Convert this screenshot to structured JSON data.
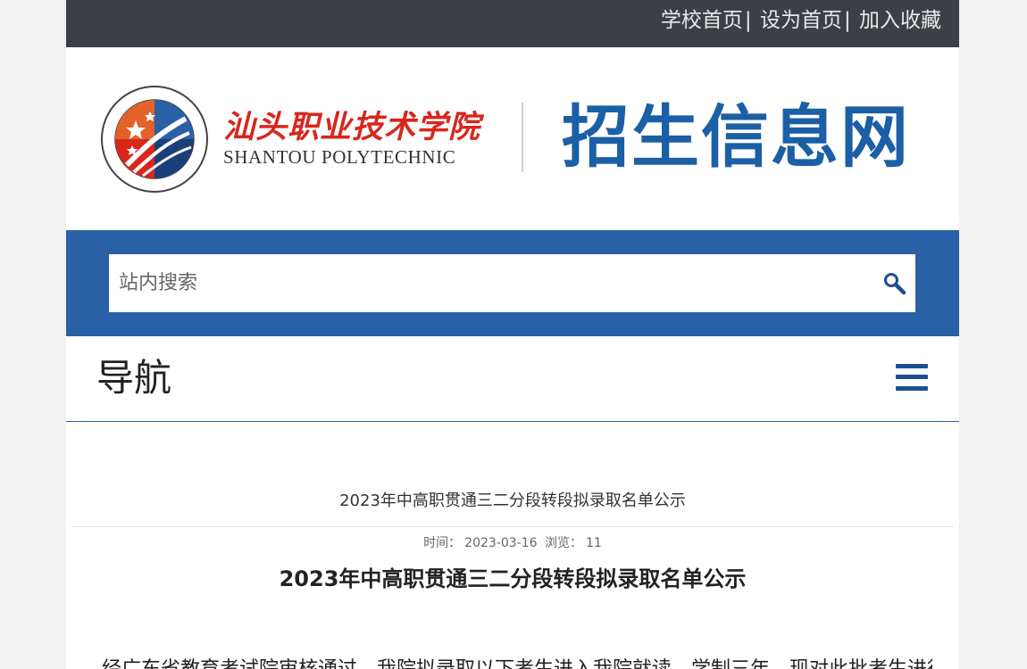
{
  "topbar": {
    "links": [
      "学校首页",
      "设为首页",
      "加入收藏"
    ],
    "separator": "|"
  },
  "header": {
    "school_name_cn": "汕头职业技术学院",
    "school_name_en": "SHANTOU POLYTECHNIC",
    "emblem_ring_text": "汕头职业技术学院 SHANTOU POLYTECHNIC",
    "site_title": "招生信息网"
  },
  "search": {
    "placeholder": "站内搜索",
    "icon": "search-icon"
  },
  "nav": {
    "title": "导航",
    "menu_icon": "hamburger-menu-icon"
  },
  "article": {
    "list_title": "2023年中高职贯通三二分段转段拟录取名单公示",
    "meta": {
      "time_label": "时间：",
      "time_value": "2023-03-16",
      "views_label": "浏览：",
      "views_value": "11"
    },
    "title": "2023年中高职贯通三二分段转段拟录取名单公示",
    "body_first_line": "经广东省教育考试院审核通过，我院拟录取以下考生进入我院就读，学制三年，现对此批考生进行公"
  },
  "colors": {
    "topbar_bg": "#3c4046",
    "brand_blue": "#2a60a6",
    "title_blue": "#1b5fa6",
    "logo_red": "#d9261c"
  }
}
